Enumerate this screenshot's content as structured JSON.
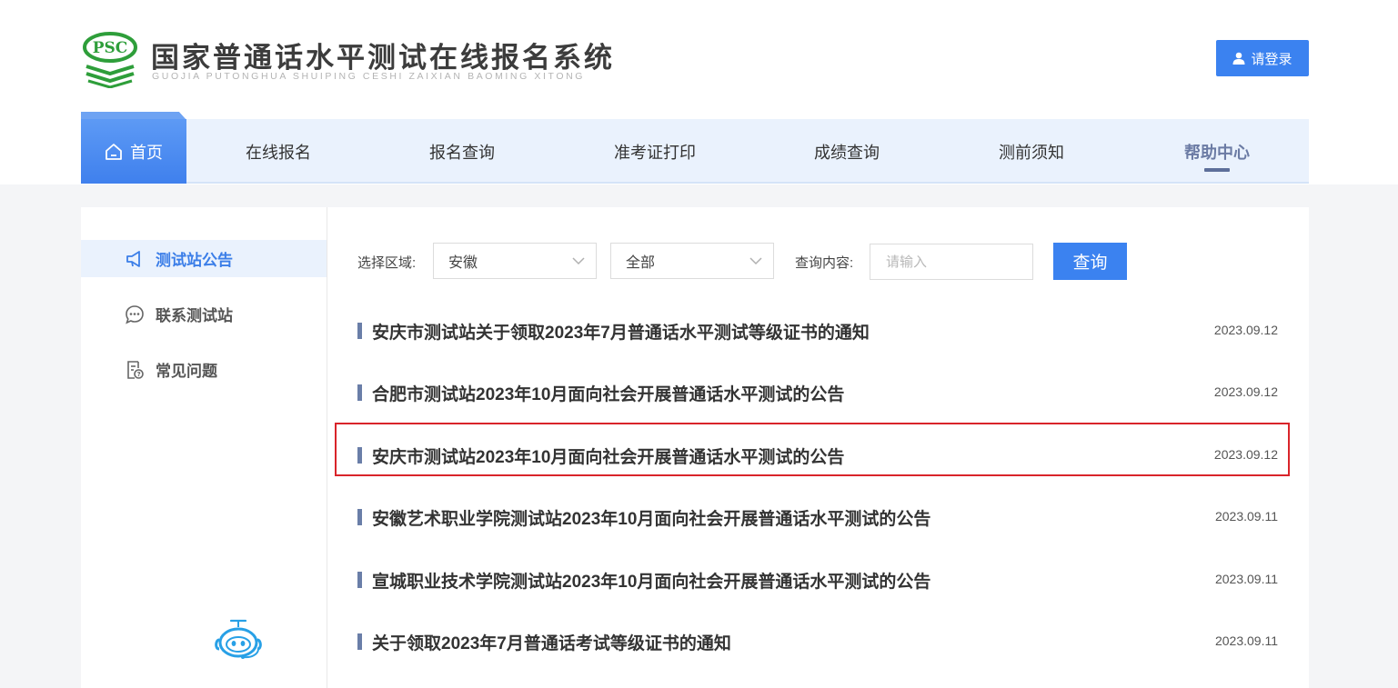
{
  "header": {
    "title": "国家普通话水平测试在线报名系统",
    "subtitle": "GUOJIA PUTONGHUA SHUIPING CESHI ZAIXIAN BAOMING XITONG",
    "logo_text": "PSC",
    "login_label": "请登录"
  },
  "nav": {
    "items": [
      {
        "label": "首页"
      },
      {
        "label": "在线报名"
      },
      {
        "label": "报名查询"
      },
      {
        "label": "准考证打印"
      },
      {
        "label": "成绩查询"
      },
      {
        "label": "测前须知"
      },
      {
        "label": "帮助中心"
      }
    ],
    "active": "帮助中心"
  },
  "sidebar": {
    "items": [
      {
        "label": "测试站公告",
        "icon": "megaphone-icon",
        "active": true
      },
      {
        "label": "联系测试站",
        "icon": "chat-bubble-icon",
        "active": false
      },
      {
        "label": "常见问题",
        "icon": "document-question-icon",
        "active": false
      }
    ]
  },
  "filter": {
    "region_label": "选择区域:",
    "province_value": "安徽",
    "city_value": "全部",
    "query_label": "查询内容:",
    "query_placeholder": "请输入",
    "search_label": "查询"
  },
  "notices": [
    {
      "title": "安庆市测试站关于领取2023年7月普通话水平测试等级证书的通知",
      "date": "2023.09.12"
    },
    {
      "title": "合肥市测试站2023年10月面向社会开展普通话水平测试的公告",
      "date": "2023.09.12"
    },
    {
      "title": "安庆市测试站2023年10月面向社会开展普通话水平测试的公告",
      "date": "2023.09.12",
      "highlighted": true
    },
    {
      "title": "安徽艺术职业学院测试站2023年10月面向社会开展普通话水平测试的公告",
      "date": "2023.09.11"
    },
    {
      "title": "宣城职业技术学院测试站2023年10月面向社会开展普通话水平测试的公告",
      "date": "2023.09.11"
    },
    {
      "title": "关于领取2023年7月普通话考试等级证书的通知",
      "date": "2023.09.11"
    }
  ],
  "colors": {
    "primary": "#3b82f0",
    "nav_bg": "#eaf2fd",
    "highlight": "#d9242a",
    "logo_green": "#2e9e3a"
  }
}
